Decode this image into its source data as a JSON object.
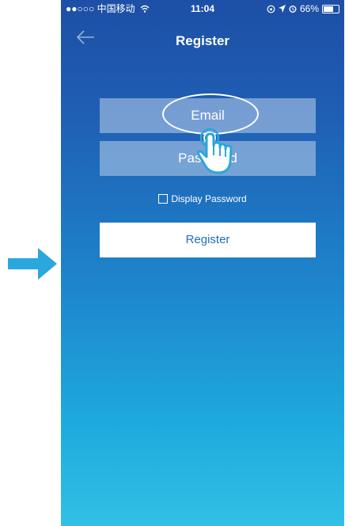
{
  "status_bar": {
    "carrier": "●●○○○ 中国移动",
    "time": "11:04",
    "battery": "66%"
  },
  "nav": {
    "title": "Register"
  },
  "form": {
    "email_placeholder": "Email",
    "password_placeholder": "Password",
    "display_password_label": "Display Password",
    "register_label": "Register"
  },
  "colors": {
    "arrow": "#2aa7dc",
    "gradient_top": "#1d4fa6",
    "gradient_bottom": "#31c0e5",
    "register_text": "#1f6fbf"
  },
  "icons": [
    "right-arrow-icon",
    "back-arrow-icon",
    "wifi-icon",
    "battery-icon",
    "tap-hand-icon"
  ]
}
